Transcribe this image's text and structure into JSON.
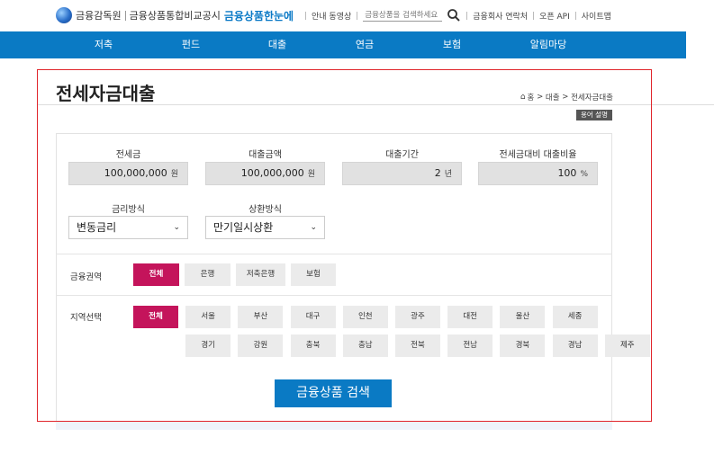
{
  "header": {
    "logo_org": "금융감독원",
    "logo_site": "금융상품통합비교공시",
    "logo_brand": "금융상품한눈에",
    "util_links": [
      "안내 동영상",
      "금융회사 연락처",
      "오픈 API",
      "사이트맵"
    ],
    "search_placeholder": "금융상품을 검색하세요"
  },
  "nav": {
    "items": [
      "저축",
      "펀드",
      "대출",
      "연금",
      "보험",
      "알림마당"
    ]
  },
  "page": {
    "title": "전세자금대출",
    "breadcrumb": [
      "홈",
      "대출",
      "전세자금대출"
    ],
    "help_label": "용어 설명"
  },
  "form": {
    "fields": [
      {
        "label": "전세금",
        "value": "100,000,000",
        "unit": "원"
      },
      {
        "label": "대출금액",
        "value": "100,000,000",
        "unit": "원"
      },
      {
        "label": "대출기간",
        "value": "2",
        "unit": "년"
      },
      {
        "label": "전세금대비 대출비율",
        "value": "100",
        "unit": "%"
      }
    ],
    "selects": [
      {
        "label": "금리방식",
        "value": "변동금리"
      },
      {
        "label": "상환방식",
        "value": "만기일시상환"
      }
    ],
    "sector": {
      "label": "금융권역",
      "options": [
        "전체",
        "은행",
        "저축은행",
        "보험"
      ],
      "selected": "전체"
    },
    "region": {
      "label": "지역선택",
      "options": [
        "전체",
        "서울",
        "부산",
        "대구",
        "인천",
        "광주",
        "대전",
        "울산",
        "세종",
        "경기",
        "강원",
        "충북",
        "충남",
        "전북",
        "전남",
        "경북",
        "경남",
        "제주"
      ],
      "selected": "전체"
    },
    "submit_label": "금융상품 검색"
  },
  "colors": {
    "primary": "#0a7ac4",
    "accent": "#c4145b",
    "frame": "#e0252b"
  }
}
